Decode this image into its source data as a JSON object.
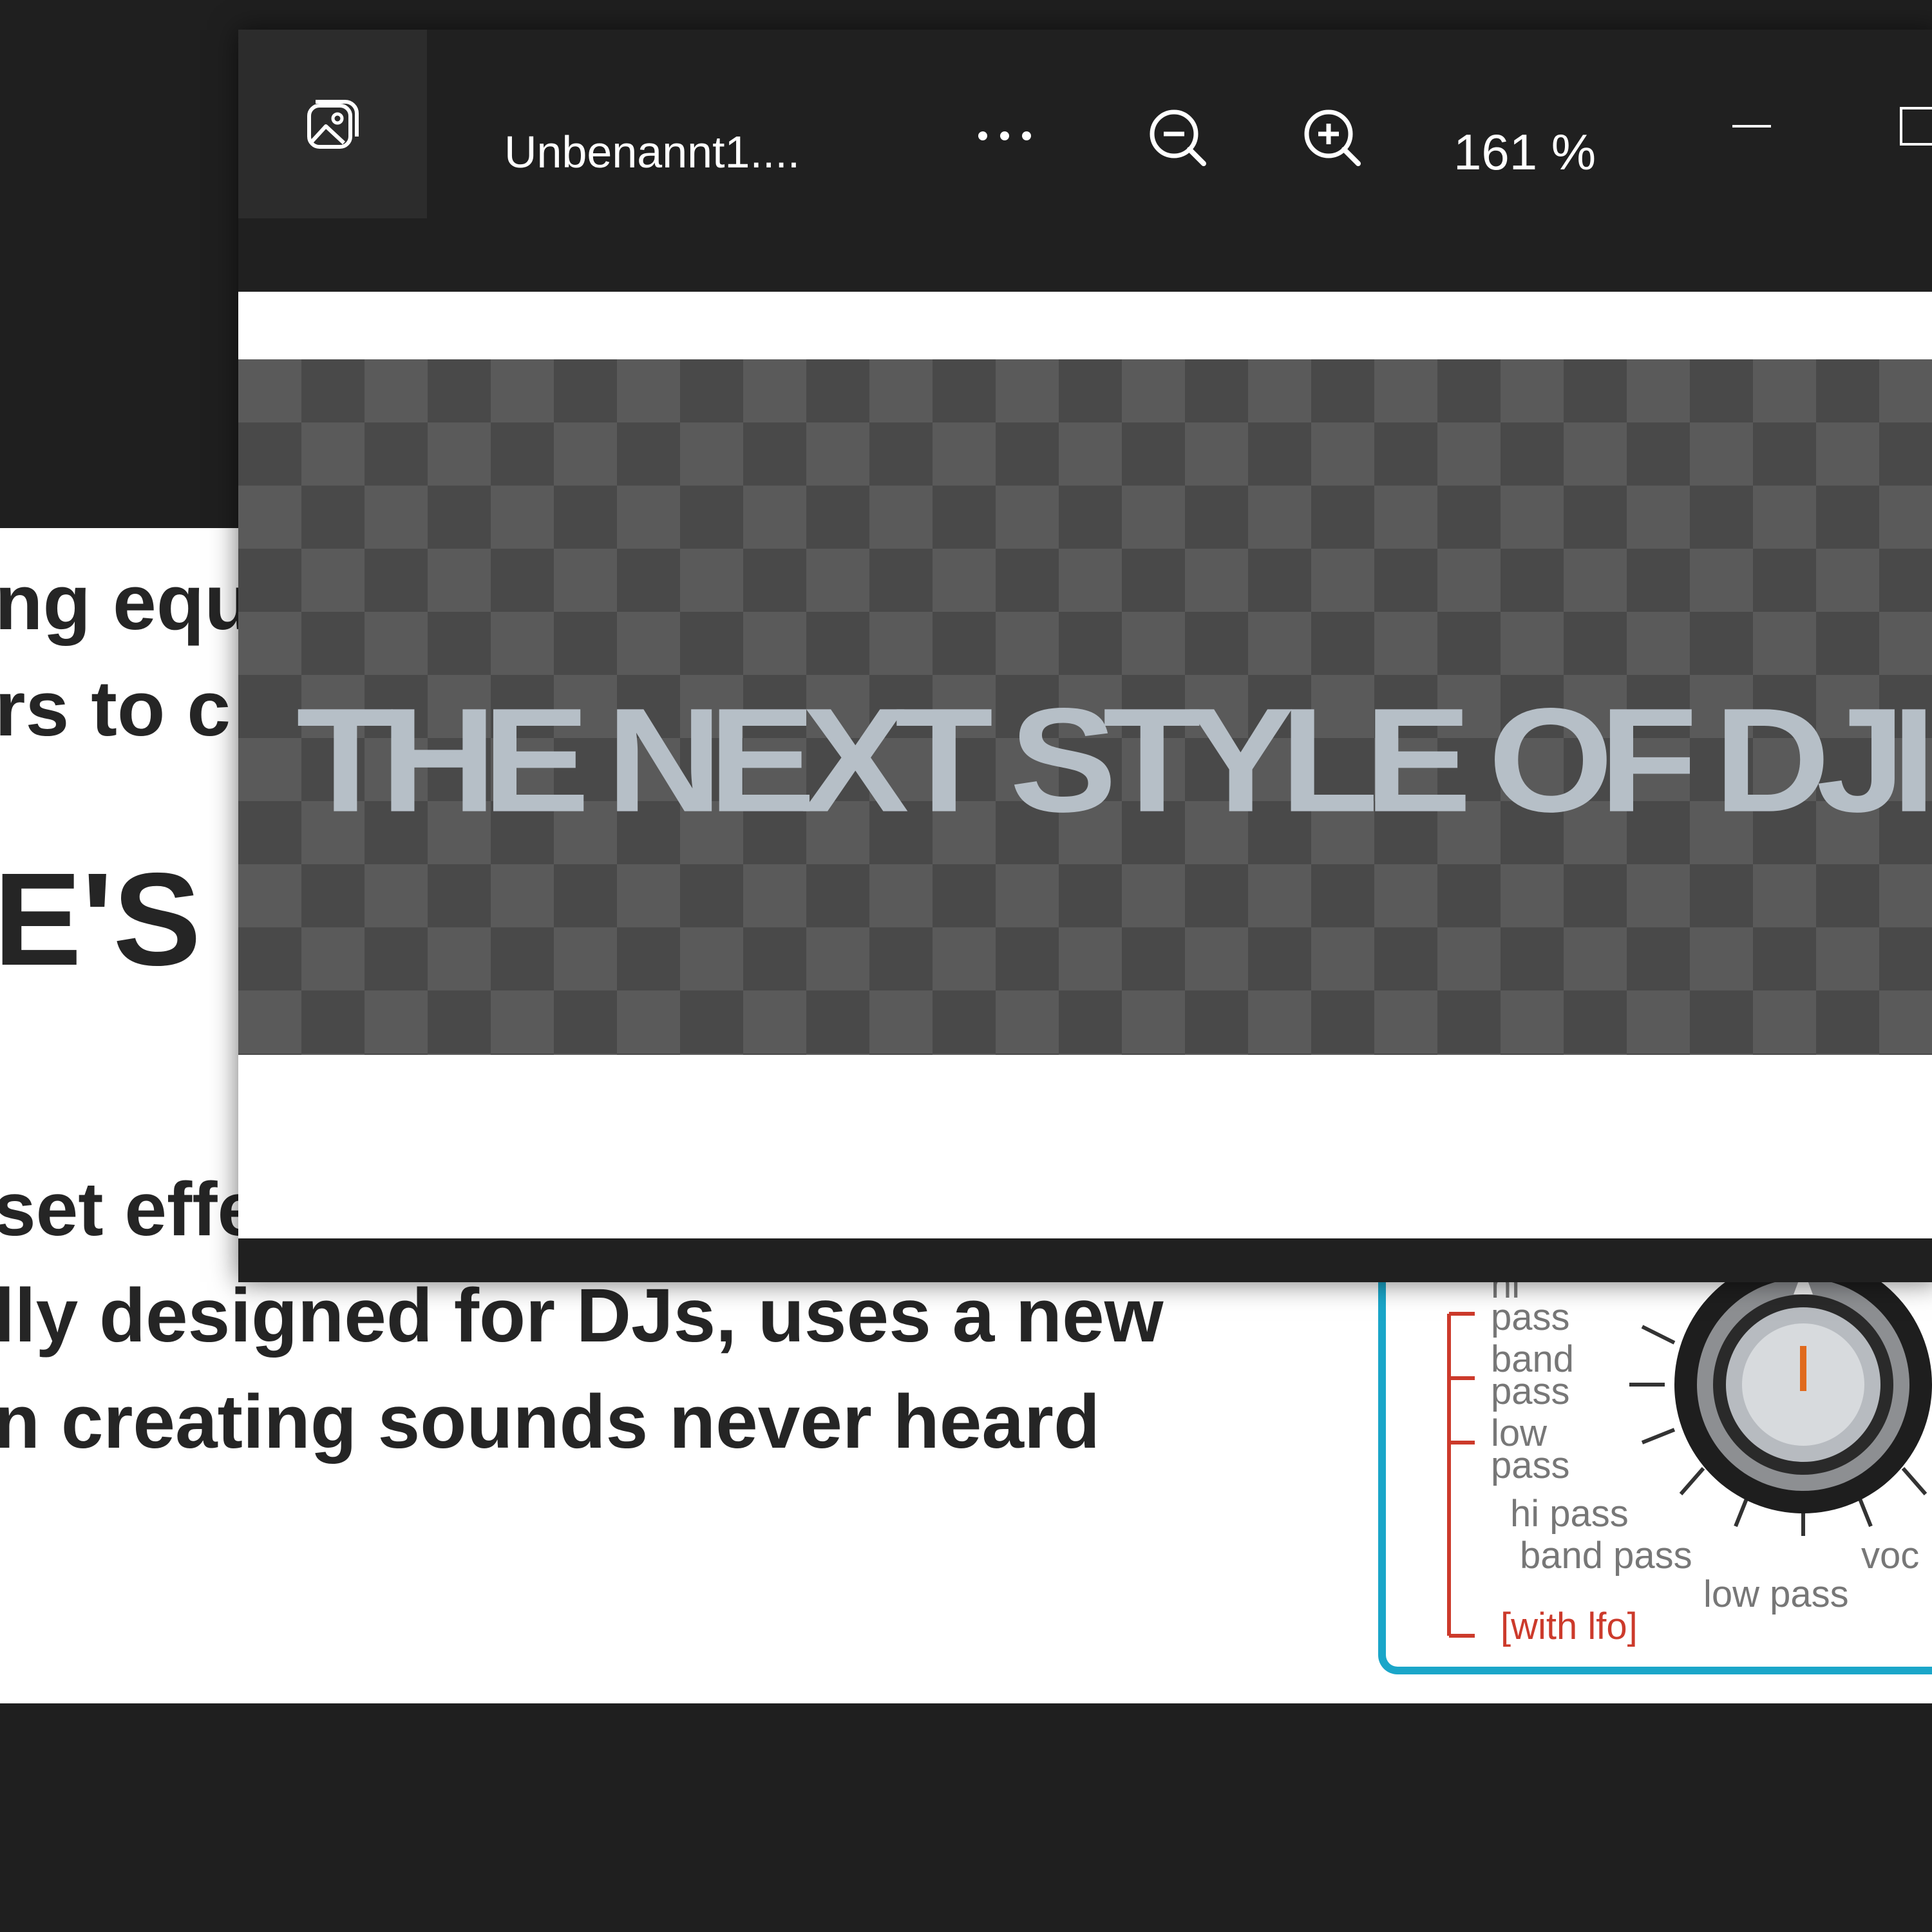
{
  "background_page": {
    "line1": "ng equ",
    "line2": "rs to c",
    "heading": "E'S",
    "para_line1": "set effe",
    "para_line2": "lly designed for DJs, uses a new",
    "para_line3": "n creating sounds never heard",
    "diagram": {
      "labels": [
        "hi",
        "pass",
        "band",
        "pass",
        "low",
        "pass",
        "hi pass",
        "band pass",
        "low pass",
        "voc"
      ],
      "lfo_label": "[with lfo]",
      "accent_color": "#1aa6c9",
      "bracket_color": "#cc3a2b"
    }
  },
  "viewer": {
    "app_icon": "photos-app-icon",
    "file_name": "Unbenannt1....",
    "more_icon": "more-options-icon",
    "zoom_out_icon": "zoom-out-icon",
    "zoom_in_icon": "zoom-in-icon",
    "zoom_level": "161 %",
    "minimize_icon": "minimize-icon",
    "maximize_icon": "maximize-icon",
    "image_text": "THE NEXT STYLE OF DJIN",
    "banner_text_color": "#b6bfc7"
  }
}
